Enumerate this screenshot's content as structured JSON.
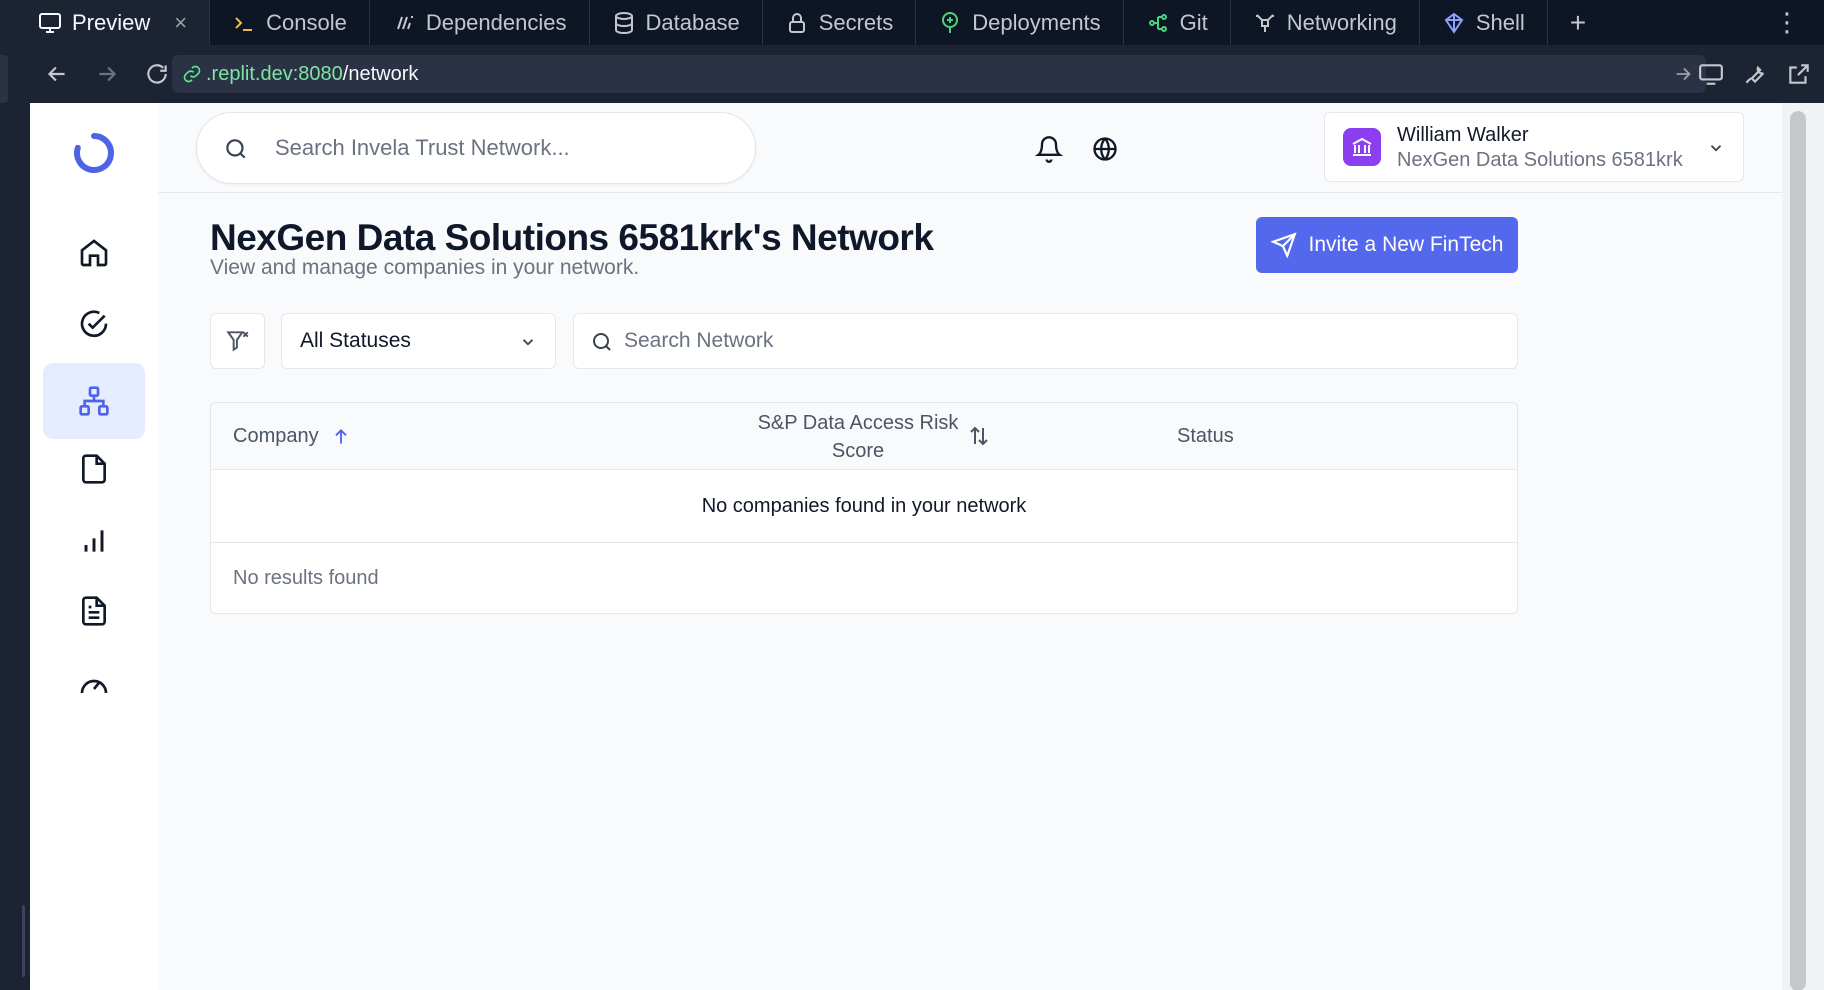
{
  "ide_tabs": [
    {
      "label": "Preview",
      "icon": "monitor-icon",
      "active": true,
      "closable": true
    },
    {
      "label": "Console",
      "icon": "terminal-icon"
    },
    {
      "label": "Dependencies",
      "icon": "dependencies-icon"
    },
    {
      "label": "Database",
      "icon": "database-icon"
    },
    {
      "label": "Secrets",
      "icon": "lock-icon"
    },
    {
      "label": "Deployments",
      "icon": "deployments-icon"
    },
    {
      "label": "Git",
      "icon": "git-icon"
    },
    {
      "label": "Networking",
      "icon": "networking-icon"
    },
    {
      "label": "Shell",
      "icon": "shell-icon"
    }
  ],
  "ide": {
    "close_glyph": "×",
    "add_tab_glyph": "+",
    "menu_glyph": "⋮"
  },
  "address_bar": {
    "host": ".replit.dev:8080",
    "path": "/network"
  },
  "header": {
    "search_placeholder": "Search Invela Trust Network...",
    "user_name": "William Walker",
    "user_org": "NexGen Data Solutions 6581krk"
  },
  "sidebar": {
    "items": [
      {
        "name": "home",
        "icon": "home-icon"
      },
      {
        "name": "tasks",
        "icon": "check-circle-icon"
      },
      {
        "name": "network",
        "icon": "network-icon",
        "active": true
      },
      {
        "name": "file-vault",
        "icon": "file-icon"
      },
      {
        "name": "insights",
        "icon": "bar-chart-icon"
      },
      {
        "name": "documents",
        "icon": "document-text-icon"
      },
      {
        "name": "risk-score",
        "icon": "gauge-icon"
      }
    ]
  },
  "page": {
    "title": "NexGen Data Solutions 6581krk's Network",
    "subtitle": "View and manage companies in your network.",
    "invite_label": "Invite a New FinTech"
  },
  "filters": {
    "status_selected": "All Statuses",
    "search_placeholder": "Search Network"
  },
  "table": {
    "columns": [
      "Company",
      "S&P Data Access Risk Score",
      "Status"
    ],
    "empty_message": "No companies found in your network",
    "footer_message": "No results found"
  },
  "colors": {
    "accent": "#5468ee",
    "active_nav_bg": "#e6ecff",
    "org_badge": "#8b3ff0"
  }
}
